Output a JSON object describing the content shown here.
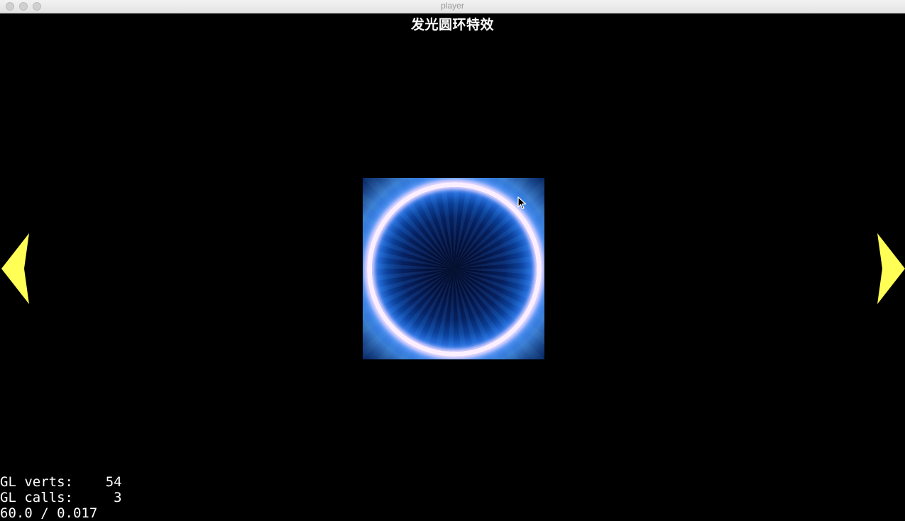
{
  "window": {
    "title": "player"
  },
  "scene": {
    "title": "发光圆环特效",
    "effect_name": "glow-ring-effect"
  },
  "navigation": {
    "prev_icon": "triangle-left-icon",
    "next_icon": "triangle-right-icon",
    "arrow_color": "#ffff55"
  },
  "stats": {
    "verts": "GL verts:    54",
    "calls": "GL calls:     3",
    "fps": "60.0 / 0.017"
  },
  "colors": {
    "background": "#000000",
    "ring": "#fbeeff",
    "glow": "#1a72e0"
  }
}
